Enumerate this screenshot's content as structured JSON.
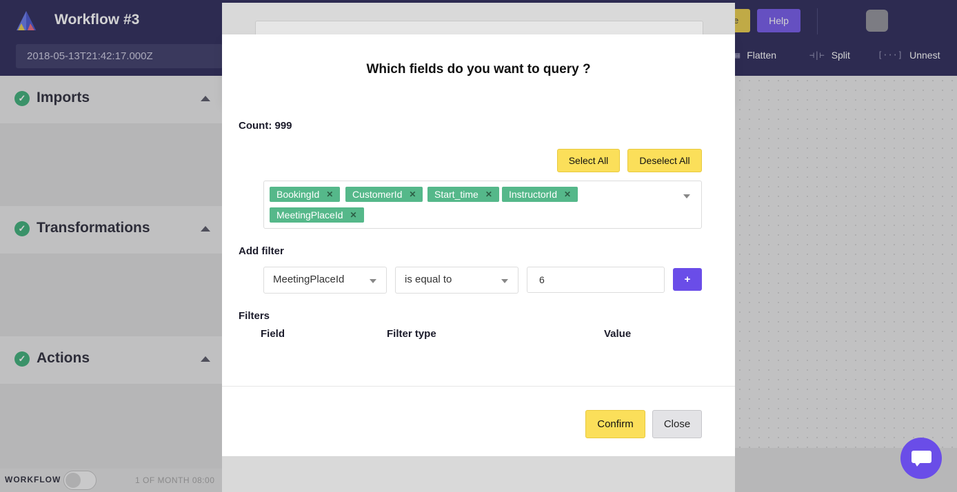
{
  "app": {
    "title": "Workflow #3",
    "date_value": "2018-05-13T21:42:17.000Z",
    "help_label": "Help",
    "toolbar": [
      {
        "label": "Flatten",
        "icon": "flatten-icon"
      },
      {
        "label": "Split",
        "icon": "split-icon"
      },
      {
        "label": "Unnest",
        "icon": "unnest-icon"
      }
    ]
  },
  "sidebar": {
    "sections": [
      {
        "title": "Imports",
        "status": "check-icon"
      },
      {
        "title": "Transformations",
        "status": "check-icon"
      },
      {
        "title": "Actions",
        "status": "check-icon"
      }
    ],
    "footer": {
      "label": "WORKFLOW",
      "toggle_on": false,
      "schedule": "1 OF MONTH 08:00"
    }
  },
  "modal": {
    "title": "Which fields do you want to query ?",
    "count_label": "Count: 999",
    "select_all_label": "Select All",
    "deselect_all_label": "Deselect All",
    "selected_fields": [
      "BookingId",
      "CustomerId",
      "Start_time",
      "InstructorId",
      "MeetingPlaceId"
    ],
    "add_filter_label": "Add filter",
    "filter_field_value": "MeetingPlaceId",
    "filter_type_value": "is equal to",
    "filter_value": "6",
    "add_button_label": "+",
    "filters_label": "Filters",
    "filters_columns": [
      "Field",
      "Filter type",
      "Value"
    ],
    "confirm_label": "Confirm",
    "close_label": "Close"
  },
  "colors": {
    "nav_bg": "#1c1a4d",
    "accent_purple": "#6a4de8",
    "accent_yellow": "#fbdf5a",
    "tag_green": "#55b88a",
    "status_green": "#2fa86e"
  }
}
